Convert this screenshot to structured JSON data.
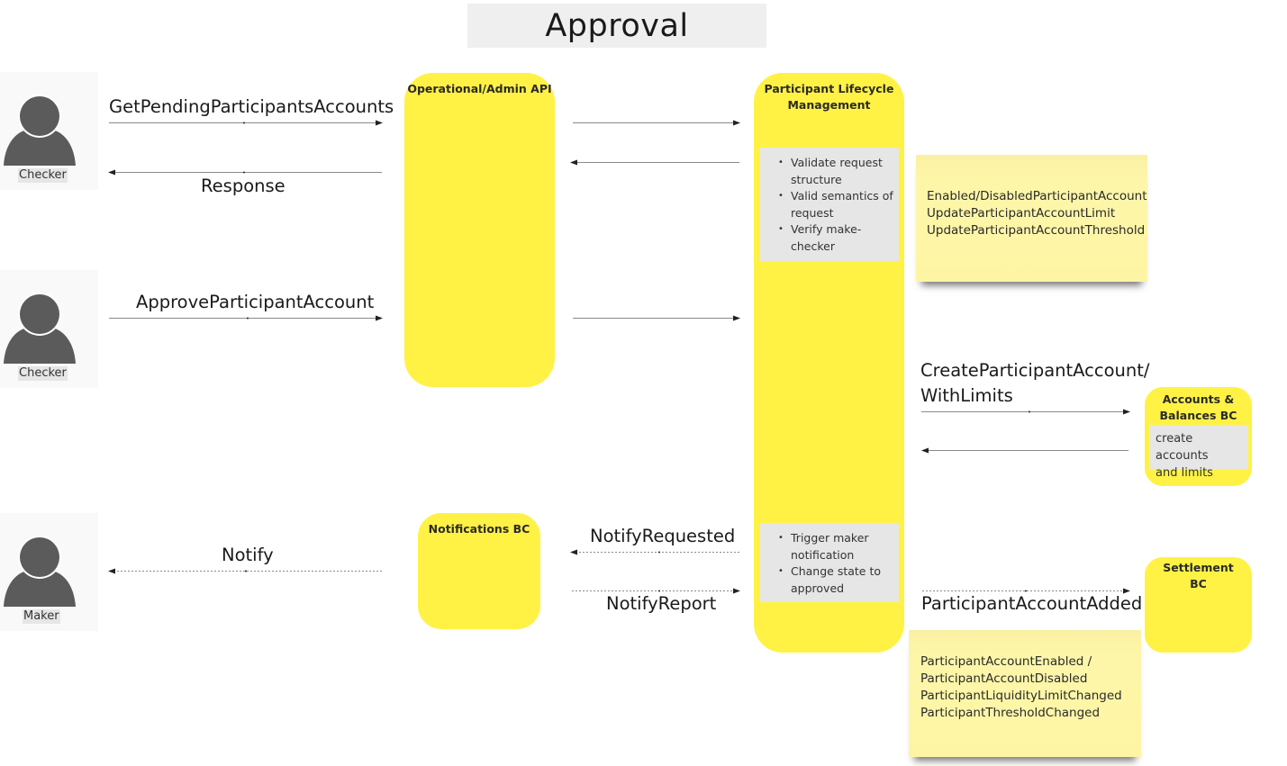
{
  "title": "Approval",
  "actors": [
    {
      "label": "Checker",
      "icon": "person-icon"
    },
    {
      "label": "Checker",
      "icon": "person-icon"
    },
    {
      "label": "Maker",
      "icon": "person-icon"
    }
  ],
  "components": {
    "admin_api": {
      "title": "Operational/Admin API"
    },
    "plm": {
      "title_line1": "Participant Lifecycle",
      "title_line2": "Management",
      "steps_top": [
        "Validate request",
        "structure",
        "Valid semantics of",
        "request",
        "Verify make-",
        "checker"
      ],
      "steps_bottom": [
        "Trigger maker",
        "notification",
        "Change state to",
        "approved"
      ]
    },
    "notifications": {
      "title": "Notifications BC"
    },
    "accounts": {
      "title_line1": "Accounts &",
      "title_line2": "Balances BC",
      "note_line1": "create accounts",
      "note_line2": "and limits"
    },
    "settlement": {
      "title_line1": "Settlement",
      "title_line2": "BC"
    }
  },
  "messages": {
    "get_pending": "GetPendingParticipantsAccounts",
    "response": "Response",
    "approve": "ApproveParticipantAccount",
    "notify": "Notify",
    "notify_requested": "NotifyRequested",
    "notify_report": "NotifyReport",
    "create_line1": "CreateParticipantAccount/",
    "create_line2": "WithLimits",
    "account_added": "ParticipantAccountAdded"
  },
  "stickies": {
    "commands": [
      "Enabled/DisabledParticipantAccount",
      "UpdateParticipantAccountLimit",
      "UpdateParticipantAccountThreshold"
    ],
    "events": [
      "ParticipantAccountEnabled /",
      "ParticipantAccountDisabled",
      "ParticipantLiquidityLimitChanged",
      "ParticipantThresholdChanged"
    ]
  },
  "colors": {
    "lane_yellow": "#fff245",
    "sticky_yellow": "#fef5a4",
    "note_gray": "#e6e6e6",
    "actor_gray": "#5b5b5b"
  }
}
